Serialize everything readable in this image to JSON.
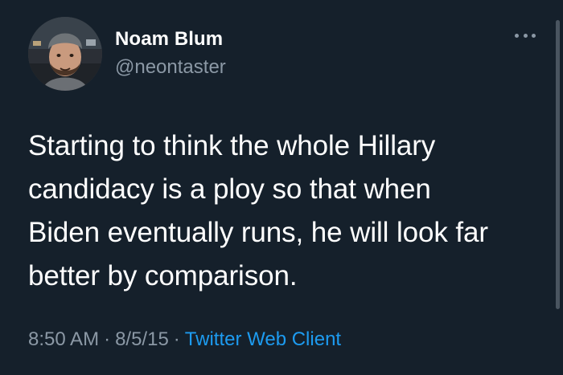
{
  "user": {
    "name": "Noam Blum",
    "handle": "@neontaster"
  },
  "tweet": {
    "text": "Starting to think the whole Hillary\ncandidacy is a ploy so that when\nBiden eventually runs, he will look far\nbetter by comparison.",
    "time": "8:50 AM",
    "date": "8/5/15",
    "separator": "·",
    "client": "Twitter Web Client"
  },
  "icons": {
    "more": "more-options-icon",
    "avatar": "profile-avatar"
  },
  "colors": {
    "background": "#15202b",
    "text_primary": "#ffffff",
    "text_secondary": "#8b98a5",
    "link": "#1d9bf0"
  }
}
